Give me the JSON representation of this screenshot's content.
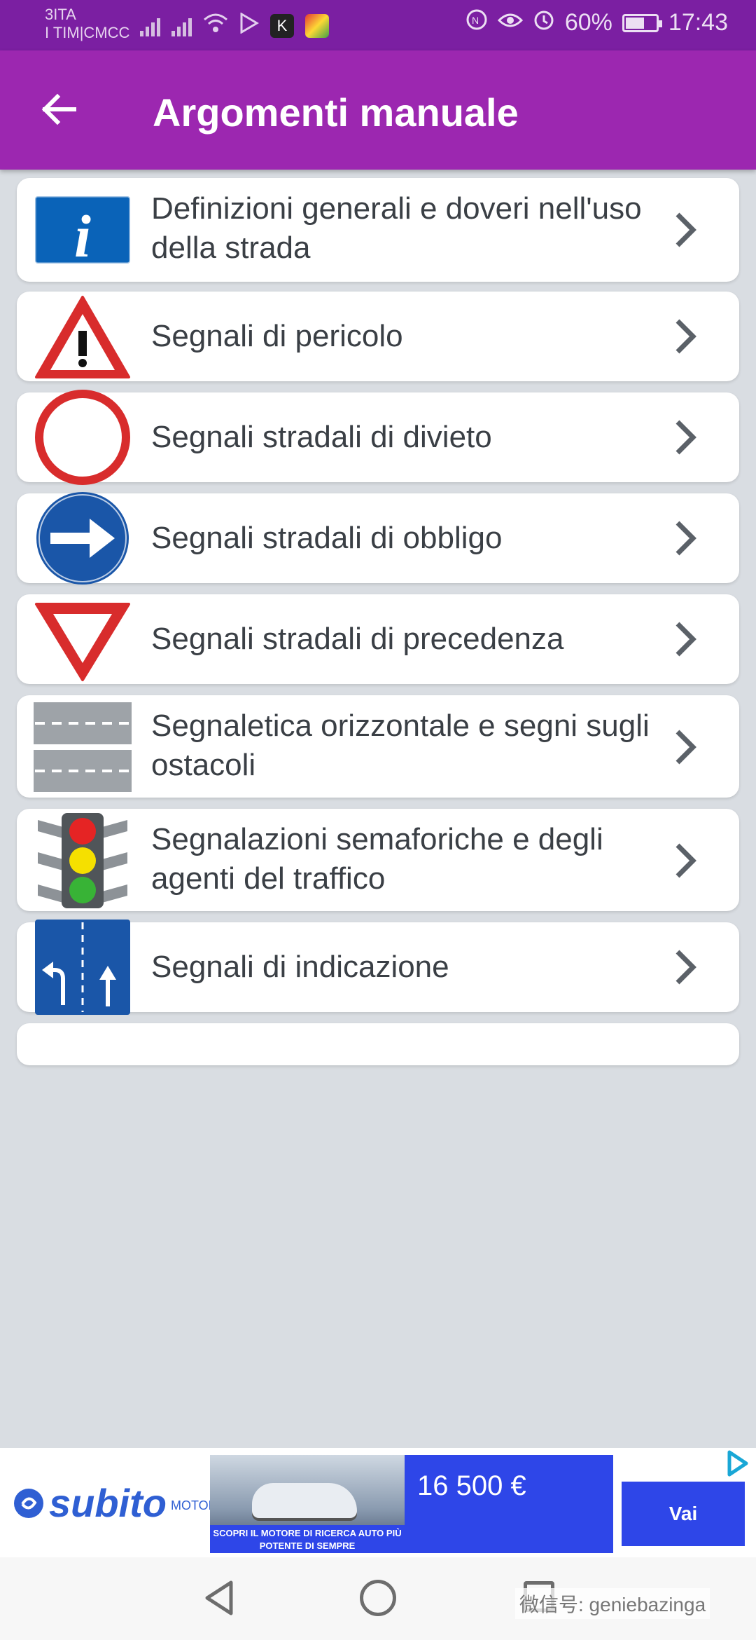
{
  "status_bar": {
    "carrier_line1": "3ITA",
    "carrier_line2": "I TIM|CMCC",
    "battery": "60%",
    "time": "17:43",
    "battery_level": 0.6
  },
  "app_bar": {
    "title": "Argomenti manuale",
    "back_icon": "arrow-left-icon"
  },
  "list": {
    "items": [
      {
        "label": "Definizioni generali e doveri nell'uso della strada",
        "icon": "info-sign-icon"
      },
      {
        "label": "Segnali di pericolo",
        "icon": "warning-triangle-icon"
      },
      {
        "label": "Segnali stradali di divieto",
        "icon": "prohibition-circle-icon"
      },
      {
        "label": "Segnali stradali di obbligo",
        "icon": "mandatory-arrow-icon"
      },
      {
        "label": "Segnali stradali di precedenza",
        "icon": "give-way-triangle-icon"
      },
      {
        "label": "Segnaletica orizzontale e segni sugli ostacoli",
        "icon": "road-markings-icon"
      },
      {
        "label": "Segnalazioni semaforiche e degli agenti del traffico",
        "icon": "traffic-light-icon"
      },
      {
        "label": "Segnali di indicazione",
        "icon": "lane-direction-icon"
      }
    ]
  },
  "ad": {
    "brand": "subito",
    "brand_suffix": "MOTORI",
    "caption": "SCOPRI IL MOTORE DI RICERCA AUTO PIÙ POTENTE DI SEMPRE",
    "price": "16 500 €",
    "cta": "Vai"
  },
  "nav_bar": {
    "watermark": "微信号: geniebazinga"
  },
  "colors": {
    "status_bar": "#7b1fa2",
    "app_bar": "#9c27b0",
    "background": "#d9dde2",
    "ad_blue": "#2e46e8"
  }
}
